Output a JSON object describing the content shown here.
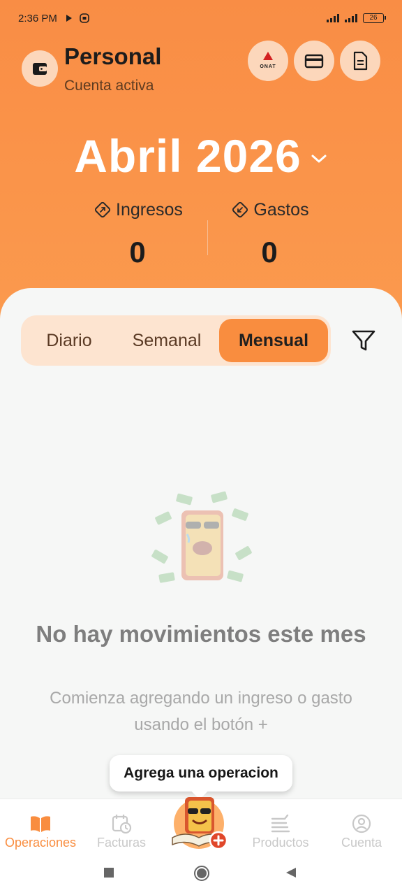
{
  "status_bar": {
    "time": "2:36 PM",
    "battery": "26"
  },
  "header": {
    "account_title": "Personal",
    "account_subtitle": "Cuenta activa",
    "month_label": "Abril 2026",
    "onat_logo_text": "ONAT",
    "income": {
      "label": "Ingresos",
      "value": "0"
    },
    "expenses": {
      "label": "Gastos",
      "value": "0"
    }
  },
  "period_tabs": {
    "items": [
      "Diario",
      "Semanal",
      "Mensual"
    ],
    "selected": "Mensual"
  },
  "empty_state": {
    "title": "No hay movimientos este mes",
    "subtitle": "Comienza agregando un ingreso o gasto usando el botón +"
  },
  "tooltip": {
    "text": "Agrega una operacion"
  },
  "bottom_nav": {
    "items": [
      {
        "label": "Operaciones",
        "icon": "book-icon",
        "active": true
      },
      {
        "label": "Facturas",
        "icon": "calendar-clock-icon",
        "active": false
      },
      {
        "label": "Productos",
        "icon": "boxes-icon",
        "active": false
      },
      {
        "label": "Cuenta",
        "icon": "user-circle-icon",
        "active": false
      }
    ]
  },
  "colors": {
    "accent": "#f98d3f",
    "header_bg": "#fb9a4e",
    "chip_bg": "#fcd7bb",
    "segment_bg": "#fde4d0"
  }
}
